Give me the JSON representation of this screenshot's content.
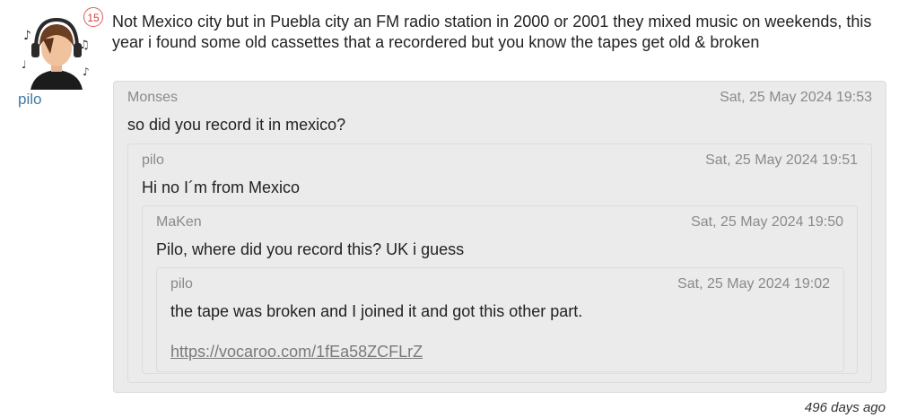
{
  "post": {
    "badge_count": "15",
    "username": "pilo",
    "text": "Not Mexico city but in Puebla city an FM radio station in 2000 or 2001 they mixed music on weekends, this year i found some old cassettes that a recordered but you know the tapes get old & broken",
    "time_ago": "496 days ago"
  },
  "quotes": [
    {
      "author": "Monses",
      "date": "Sat, 25 May 2024 19:53",
      "text": "so did you record it in mexico?"
    },
    {
      "author": "pilo",
      "date": "Sat, 25 May 2024 19:51",
      "text": "Hi no I´m from Mexico"
    },
    {
      "author": "MaKen",
      "date": "Sat, 25 May 2024 19:50",
      "text": "Pilo, where did you record this? UK i guess"
    },
    {
      "author": "pilo",
      "date": "Sat, 25 May 2024 19:02",
      "text": "the tape was broken and I joined it and got this other part.",
      "link": "https://vocaroo.com/1fEa58ZCFLrZ"
    }
  ]
}
